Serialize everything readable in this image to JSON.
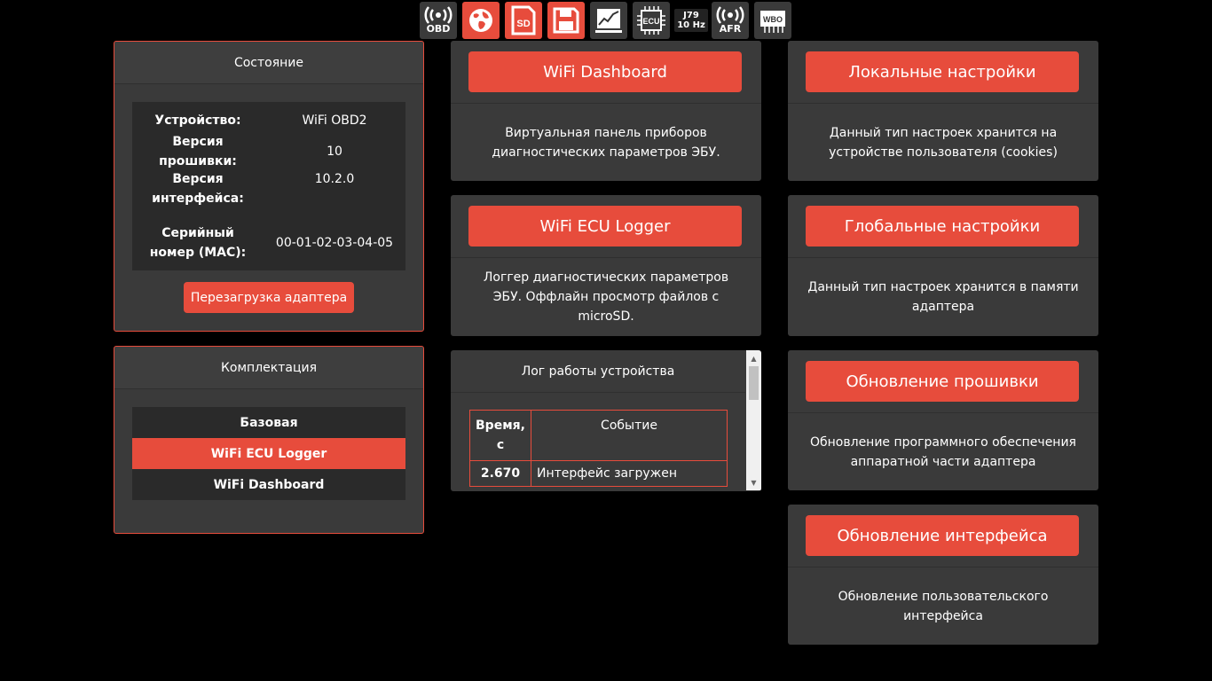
{
  "toolbar": {
    "obd_label": "OBD",
    "sd_label": "SD",
    "ecu_label": "ECU",
    "j79_line1": "J79",
    "j79_line2": "10 Hz",
    "afr_label": "AFR",
    "wbo_label": "WBO"
  },
  "status": {
    "title": "Состояние",
    "rows": [
      {
        "key": "Устройство:",
        "value": "WiFi OBD2"
      },
      {
        "key": "Версия прошивки:",
        "value": "10"
      },
      {
        "key": "Версия интерфейса:",
        "value": "10.2.0"
      },
      {
        "key": "Серийный номер (MAC):",
        "value": "00-01-02-03-04-05"
      }
    ],
    "reboot_button": "Перезагрузка адаптера"
  },
  "kit": {
    "title": "Комплектация",
    "items": [
      "Базовая",
      "WiFi ECU Logger",
      "WiFi Dashboard"
    ]
  },
  "cards": {
    "dashboard": {
      "button": "WiFi Dashboard",
      "desc": "Виртуальная панель приборов диагностических параметров ЭБУ."
    },
    "logger": {
      "button": "WiFi ECU Logger",
      "desc": "Логгер диагностических параметров ЭБУ. Оффлайн просмотр файлов с microSD."
    },
    "local": {
      "button": "Локальные настройки",
      "desc": "Данный тип настроек хранится на устройстве пользователя (cookies)"
    },
    "global": {
      "button": "Глобальные настройки",
      "desc": "Данный тип настроек хранится в памяти адаптера"
    },
    "firmware": {
      "button": "Обновление прошивки",
      "desc": "Обновление программного обеспечения аппаратной части адаптера"
    },
    "ui_update": {
      "button": "Обновление интерфейса",
      "desc": "Обновление пользовательского интерфейса"
    }
  },
  "log": {
    "title": "Лог работы устройства",
    "col_time": "Время, с",
    "col_event": "Событие",
    "rows": [
      {
        "time": "2.670",
        "event": "Интерфейс загружен"
      }
    ]
  },
  "colors": {
    "accent": "#e74c3c",
    "panel": "#3a3a3a",
    "background": "#000000"
  }
}
